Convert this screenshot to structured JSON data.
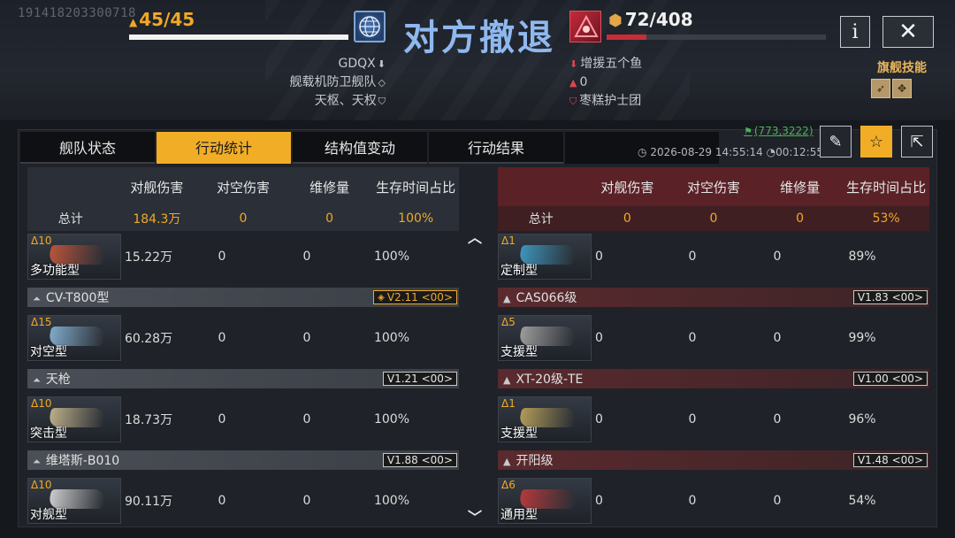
{
  "watermark": "191418203300718",
  "header": {
    "title": "对方撤退",
    "my_side": {
      "count": "45/45",
      "bar_fraction": 1.0,
      "info": [
        "GDQX",
        "舰载机防卫舰队",
        "天枢、天权"
      ]
    },
    "enemy_side": {
      "count": "72/408",
      "bar_fraction": 0.18,
      "info": [
        "增援五个鱼",
        "0",
        "枣糕护士团"
      ]
    },
    "info_button": "i",
    "close_button": "✕",
    "flagship_skill_label": "旗舰技能"
  },
  "tabs": [
    "舰队状态",
    "行动统计",
    "结构值变动",
    "行动结果"
  ],
  "active_tab": 1,
  "coords": "(773,3222)",
  "datetime": "2026-08-29 14:55:14",
  "duration": "00:12:55",
  "columns": [
    "对舰伤害",
    "对空伤害",
    "维修量",
    "生存时间占比"
  ],
  "left": {
    "total_label": "总计",
    "totals": [
      "184.3万",
      "0",
      "0",
      "100%"
    ],
    "rows": [
      {
        "kind": "ship",
        "level": "Δ10",
        "role": "多功能型",
        "color": "#b8533c",
        "values": [
          "15.22万",
          "0",
          "0",
          "100%"
        ]
      },
      {
        "kind": "group",
        "name": "CV-T800型",
        "version": "V2.11 <00>",
        "gold": true
      },
      {
        "kind": "ship",
        "level": "Δ15",
        "role": "对空型",
        "color": "#7fa9c8",
        "values": [
          "60.28万",
          "0",
          "0",
          "100%"
        ]
      },
      {
        "kind": "group",
        "name": "天枪",
        "version": "V1.21 <00>",
        "gold": false
      },
      {
        "kind": "ship",
        "level": "Δ10",
        "role": "突击型",
        "color": "#b9ac88",
        "values": [
          "18.73万",
          "0",
          "0",
          "100%"
        ]
      },
      {
        "kind": "group",
        "name": "维塔斯-B010",
        "version": "V1.88 <00>",
        "gold": false
      },
      {
        "kind": "ship",
        "level": "Δ10",
        "role": "对舰型",
        "color": "#c9c9c9",
        "values": [
          "90.11万",
          "0",
          "0",
          "100%"
        ]
      }
    ]
  },
  "right": {
    "total_label": "总计",
    "totals": [
      "0",
      "0",
      "0",
      "53%"
    ],
    "rows": [
      {
        "kind": "ship",
        "level": "Δ1",
        "role": "定制型",
        "color": "#3e93b9",
        "values": [
          "0",
          "0",
          "0",
          "89%"
        ]
      },
      {
        "kind": "group",
        "name": "CAS066级",
        "version": "V1.83 <00>",
        "gold": false
      },
      {
        "kind": "ship",
        "level": "Δ5",
        "role": "支援型",
        "color": "#9a9a9a",
        "values": [
          "0",
          "0",
          "0",
          "99%"
        ]
      },
      {
        "kind": "group",
        "name": "XT-20级-TE",
        "version": "V1.00 <00>",
        "gold": false
      },
      {
        "kind": "ship",
        "level": "Δ1",
        "role": "支援型",
        "color": "#b09a58",
        "values": [
          "0",
          "0",
          "0",
          "96%"
        ]
      },
      {
        "kind": "group",
        "name": "开阳级",
        "version": "V1.48 <00>",
        "gold": false
      },
      {
        "kind": "ship",
        "level": "Δ6",
        "role": "通用型",
        "color": "#b23a3a",
        "values": [
          "0",
          "0",
          "0",
          "54%"
        ]
      }
    ]
  },
  "icons": {
    "globe": "globe-icon",
    "enemy_emblem": "enemy-emblem-icon",
    "flag_skill_1": "missile-skill-icon",
    "flag_skill_2": "target-skill-icon",
    "edit": "edit-icon",
    "star": "star-icon",
    "share": "share-icon",
    "clock": "clock-icon",
    "timer": "timer-icon"
  },
  "colors": {
    "accent": "#f1ad26",
    "my_title": "#8fb8ef",
    "enemy": "#c72d38",
    "coords": "#4ab35a"
  }
}
